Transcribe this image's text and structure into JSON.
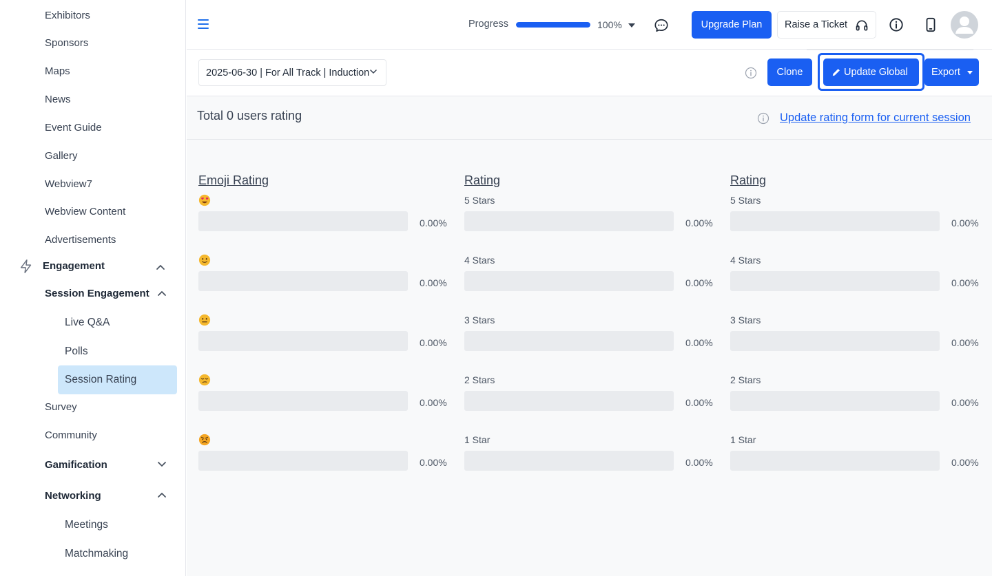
{
  "sidebar": {
    "items": [
      {
        "label": "Exhibitors"
      },
      {
        "label": "Sponsors"
      },
      {
        "label": "Maps"
      },
      {
        "label": "News"
      },
      {
        "label": "Event Guide"
      },
      {
        "label": "Gallery"
      },
      {
        "label": "Webview7"
      },
      {
        "label": "Webview Content"
      },
      {
        "label": "Advertisements"
      }
    ],
    "engagement": {
      "label": "Engagement",
      "icon": "lightning-icon"
    },
    "session_engagement": {
      "label": "Session Engagement",
      "items": [
        {
          "label": "Live Q&A"
        },
        {
          "label": "Polls"
        },
        {
          "label": "Session Rating",
          "active": true
        }
      ]
    },
    "survey": {
      "label": "Survey"
    },
    "community": {
      "label": "Community"
    },
    "gamification": {
      "label": "Gamification"
    },
    "networking": {
      "label": "Networking",
      "items": [
        {
          "label": "Meetings"
        },
        {
          "label": "Matchmaking"
        }
      ]
    }
  },
  "topbar": {
    "progress_label": "Progress",
    "progress_value": 100,
    "progress_text": "100%",
    "upgrade_label": "Upgrade Plan",
    "ticket_label": "Raise a Ticket"
  },
  "toolbar": {
    "session_value": "2025-06-30 | For All Track | Induction",
    "clone_label": "Clone",
    "update_global_label": "Update Global",
    "export_label": "Export"
  },
  "summary": {
    "total_label": "Total 0 users rating",
    "update_link": "Update rating form for current session"
  },
  "ratings": [
    {
      "title": "Emoji Rating",
      "rows": [
        {
          "emoji": "heart-eyes",
          "value": 0,
          "pct": "0.00%"
        },
        {
          "emoji": "slight-smile",
          "value": 0,
          "pct": "0.00%"
        },
        {
          "emoji": "neutral",
          "value": 0,
          "pct": "0.00%"
        },
        {
          "emoji": "unamused",
          "value": 0,
          "pct": "0.00%"
        },
        {
          "emoji": "angry",
          "value": 0,
          "pct": "0.00%"
        }
      ]
    },
    {
      "title": "Rating",
      "rows": [
        {
          "label": "5 Stars",
          "value": 0,
          "pct": "0.00%"
        },
        {
          "label": "4 Stars",
          "value": 0,
          "pct": "0.00%"
        },
        {
          "label": "3 Stars",
          "value": 0,
          "pct": "0.00%"
        },
        {
          "label": "2 Stars",
          "value": 0,
          "pct": "0.00%"
        },
        {
          "label": "1 Star",
          "value": 0,
          "pct": "0.00%"
        }
      ]
    },
    {
      "title": "Rating",
      "rows": [
        {
          "label": "5 Stars",
          "value": 0,
          "pct": "0.00%"
        },
        {
          "label": "4 Stars",
          "value": 0,
          "pct": "0.00%"
        },
        {
          "label": "3 Stars",
          "value": 0,
          "pct": "0.00%"
        },
        {
          "label": "2 Stars",
          "value": 0,
          "pct": "0.00%"
        },
        {
          "label": "1 Star",
          "value": 0,
          "pct": "0.00%"
        }
      ]
    }
  ]
}
